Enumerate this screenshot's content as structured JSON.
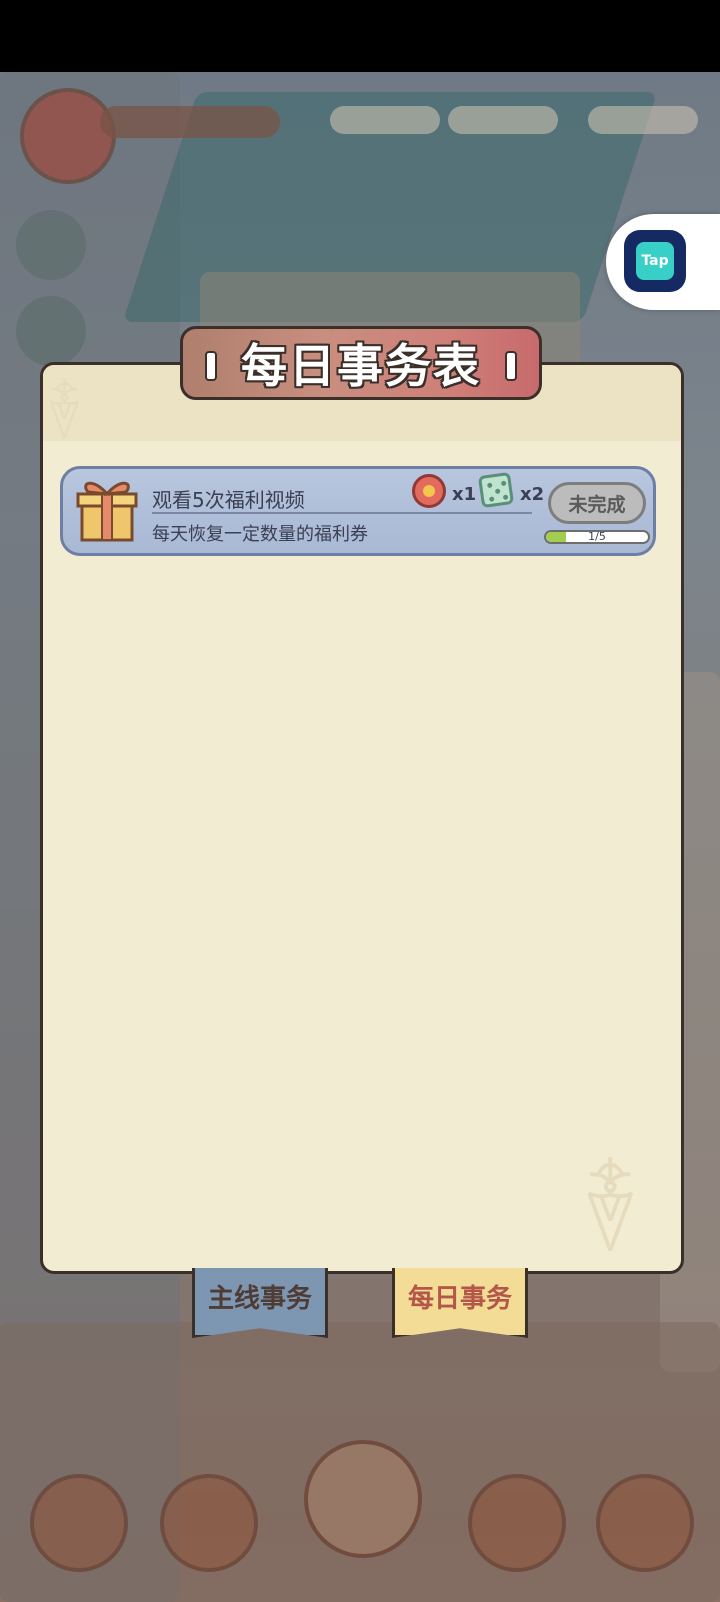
{
  "panel": {
    "title": "每日事务表"
  },
  "tasks": [
    {
      "title": "观看5次福利视频",
      "description": "每天恢复一定数量的福利券",
      "rewards": [
        {
          "icon": "flower-coin-icon",
          "count": "x1"
        },
        {
          "icon": "dice-icon",
          "count": "x2"
        }
      ],
      "status": "未完成",
      "progress_text": "1/5",
      "progress_fraction": 0.2
    }
  ],
  "tabs": [
    {
      "label": "主线事务",
      "selected": false
    },
    {
      "label": "每日事务",
      "selected": true
    }
  ],
  "tap_button": {
    "label": "Tap"
  },
  "colors": {
    "panel_bg": "#f2ecd3",
    "title_banner": "#c98e7f",
    "task_card": "#b8c6de",
    "status_button": "#bcbcbc",
    "progress_fill": "#a3cd4e",
    "tab_main": "#7d97b2",
    "tab_daily": "#f3dc96"
  }
}
